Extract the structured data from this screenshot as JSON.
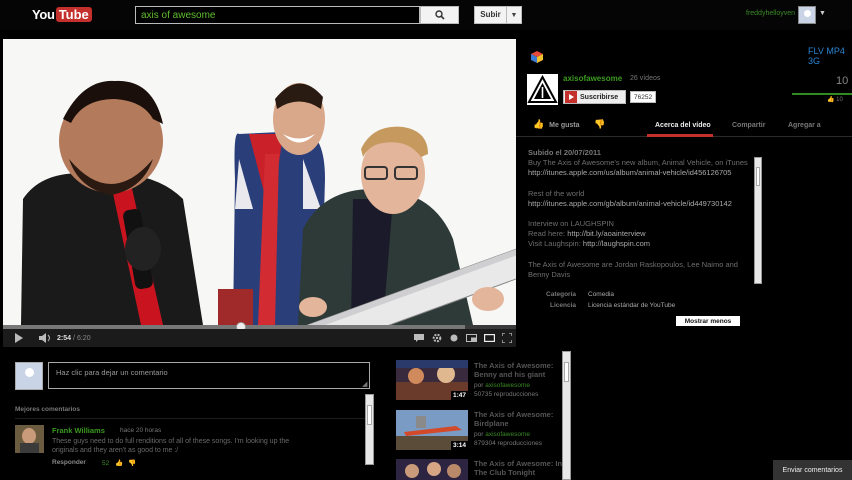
{
  "topbar": {
    "logo_you": "You",
    "logo_tube": "Tube",
    "search_value": "axis of awesome",
    "upload_label": "Subir",
    "username": "freddyhelloyven"
  },
  "player": {
    "time_current": "2:54",
    "time_total": "6:20",
    "progress": 0.459,
    "buffered": 0.9
  },
  "channel": {
    "flv_label": "FLV MP4 3G",
    "name": "axisofawesome",
    "video_count": "26 vídeos",
    "subscribe_label": "Suscribirse",
    "subscriber_count": "76252",
    "views_partial": "10",
    "likes_partial": "10"
  },
  "tabs": {
    "like": "Me gusta",
    "about": "Acerca del vídeo",
    "share": "Compartir",
    "add": "Agregar a"
  },
  "description": {
    "uploaded": "Subido el 20/07/2011",
    "line1": "Buy The Axis of Awesome's new album, Animal Vehicle, on iTunes",
    "link1": "http://itunes.apple.com/us/album/animal-vehicle/id456126705",
    "rest_world": "Rest of the world",
    "link2": "http://itunes.apple.com/gb/album/animal-vehicle/id449730142",
    "interview": "Interview on LAUGHSPIN",
    "read_label": "Read here:",
    "read_link": "http://bit.ly/aoainterview",
    "visit_label": "Visit Laughspin:",
    "visit_link": "http://laughspin.com",
    "members": "The Axis of Awesome are Jordan Raskopoulos, Lee Naimo and Benny Davis",
    "category_label": "Categoría",
    "category_value": "Comedia",
    "license_label": "Licencia",
    "license_value": "Licencia estándar de YouTube",
    "show_less": "Mostrar menos"
  },
  "comments": {
    "placeholder": "Haz clic para dejar un comentario",
    "best_label": "Mejores comentarios",
    "items": [
      {
        "author": "Frank Williams",
        "time": "hace 20 horas",
        "text": "These guys need to do full renditions of all of these songs. I'm looking up the originals and they aren't as good to me :/",
        "reply": "Responder",
        "votes": "52"
      }
    ],
    "send_label": "Enviar comentarios"
  },
  "related": [
    {
      "title": "The Axis of Awesome: Benny and his giant",
      "by_prefix": "por ",
      "channel": "axisofawesome",
      "views": "50735 reproducciones",
      "duration": "1:47"
    },
    {
      "title": "The Axis of Awesome: Birdplane",
      "by_prefix": "por ",
      "channel": "axisofawesome",
      "views": "879304 reproducciones",
      "duration": "3:14"
    },
    {
      "title": "The Axis of Awesome: In The Club Tonight",
      "by_prefix": "",
      "channel": "",
      "views": "",
      "duration": ""
    }
  ],
  "colors": {
    "accent_red": "#c4302b",
    "channel_green": "#3b9a20",
    "flv_blue": "#2a84d2"
  }
}
